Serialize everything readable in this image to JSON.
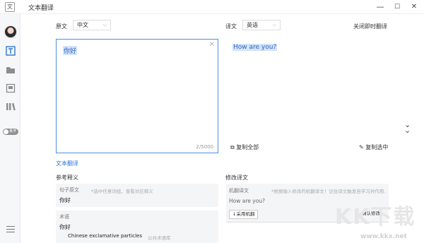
{
  "window": {
    "title": "文本翻译",
    "minimize": "—",
    "maximize": "☐",
    "close": "✕"
  },
  "sidebar": {
    "toggle_text": "悬浮"
  },
  "source": {
    "label": "原文",
    "language": "中文",
    "text": "你好",
    "counter": "2/5000",
    "clear": "×"
  },
  "target": {
    "label": "译文",
    "language": "英语",
    "text": "How are you?",
    "close_realtime": "关闭即时翻译"
  },
  "actions": {
    "copy_all": "复制全部",
    "copy_selected": "复制选中"
  },
  "link": {
    "text_translate": "文本翻译"
  },
  "reference": {
    "title": "参考释义",
    "sentence_label": "句子原文",
    "sentence_hint": "*选中任意词组，查看对应释义",
    "sentence_value": "你好",
    "term_label": "术语",
    "term_value": "你好",
    "term_translation": "Chinese exclamative particles",
    "term_source": "公共术语库"
  },
  "modify": {
    "title": "修改译文",
    "mt_label": "机翻译文",
    "mt_hint": "*根据输入修改的机翻译文！记住译文触发自学习并作用...",
    "mt_value": "How are you?",
    "adopt_button": "↓采用机翻",
    "confirm_button": "确认修改"
  },
  "watermark": {
    "big": "KK下载",
    "url": "www.kkx.net"
  }
}
